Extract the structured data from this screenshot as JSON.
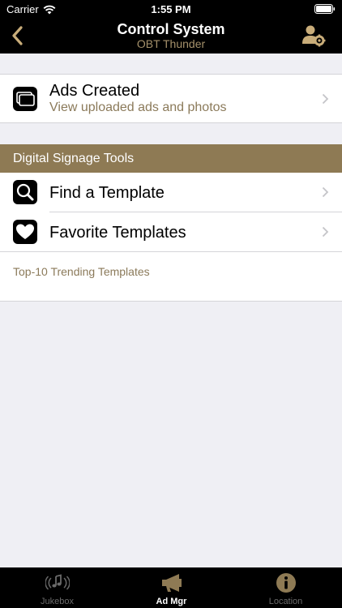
{
  "status_bar": {
    "carrier": "Carrier",
    "time": "1:55 PM"
  },
  "nav": {
    "title": "Control System",
    "subtitle": "OBT Thunder"
  },
  "ads": {
    "title": "Ads Created",
    "subtitle": "View uploaded ads and photos"
  },
  "section": {
    "header": "Digital Signage Tools",
    "items": [
      {
        "label": "Find a Template",
        "icon": "magnifier-icon"
      },
      {
        "label": "Favorite Templates",
        "icon": "heart-icon"
      }
    ],
    "trending_link": "Top-10 Trending Templates"
  },
  "tabs": [
    {
      "label": "Jukebox",
      "icon": "jukebox-icon",
      "active": false
    },
    {
      "label": "Ad Mgr",
      "icon": "megaphone-icon",
      "active": true
    },
    {
      "label": "Location",
      "icon": "info-icon",
      "active": false
    }
  ],
  "colors": {
    "accent": "#a5916b",
    "section_header": "#8e7a54",
    "bar": "#000000",
    "background": "#efeff4"
  }
}
